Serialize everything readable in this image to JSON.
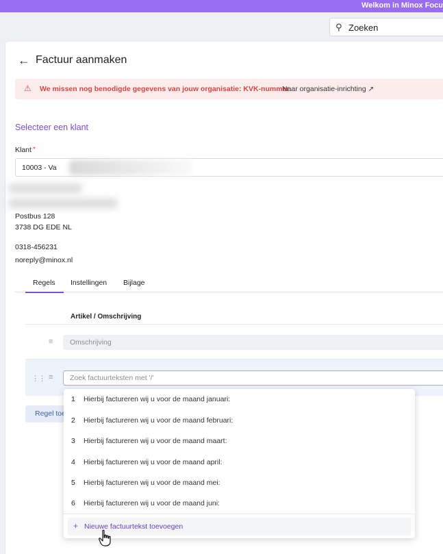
{
  "topbar": {
    "welcome_text": "Welkom in Minox Focu"
  },
  "search": {
    "label": "Zoeken"
  },
  "page": {
    "title": "Factuur aanmaken"
  },
  "alert": {
    "message": "We missen nog benodigde gegevens van jouw organisatie: KVK-nummer",
    "link_text": "Naar organisatie-inrichting"
  },
  "client": {
    "select_link": "Selecteer een klant",
    "label": "Klant",
    "required_mark": "*",
    "value": "10003 - Va",
    "address_line1": "Postbus 128",
    "address_line2": "3738 DG EDE NL",
    "phone": "0318-456231",
    "email": "noreply@minox.nl"
  },
  "tabs": [
    {
      "label": "Regels"
    },
    {
      "label": "Instellingen"
    },
    {
      "label": "Bijlage"
    }
  ],
  "table": {
    "column_header": "Artikel / Omschrijving",
    "description_placeholder": "Omschrijving",
    "search_placeholder": "Zoek factuurteksten met '/'",
    "add_row_label": "Regel toevoegen"
  },
  "dropdown": {
    "items": [
      {
        "num": "1",
        "text": "Hierbij factureren wij u voor de maand januari:"
      },
      {
        "num": "2",
        "text": "Hierbij factureren wij u voor de maand februari:"
      },
      {
        "num": "3",
        "text": "Hierbij factureren wij u voor de maand maart:"
      },
      {
        "num": "4",
        "text": "Hierbij factureren wij u voor de maand april:"
      },
      {
        "num": "5",
        "text": "Hierbij factureren wij u voor de maand mei:"
      },
      {
        "num": "6",
        "text": "Hierbij factureren wij u voor de maand juni:"
      }
    ],
    "new_label": "Nieuwe factuurtekst toevoegen"
  },
  "colors": {
    "accent": "#7a4fd1",
    "topbar": "#9a6cf2",
    "error": "#d94545"
  }
}
